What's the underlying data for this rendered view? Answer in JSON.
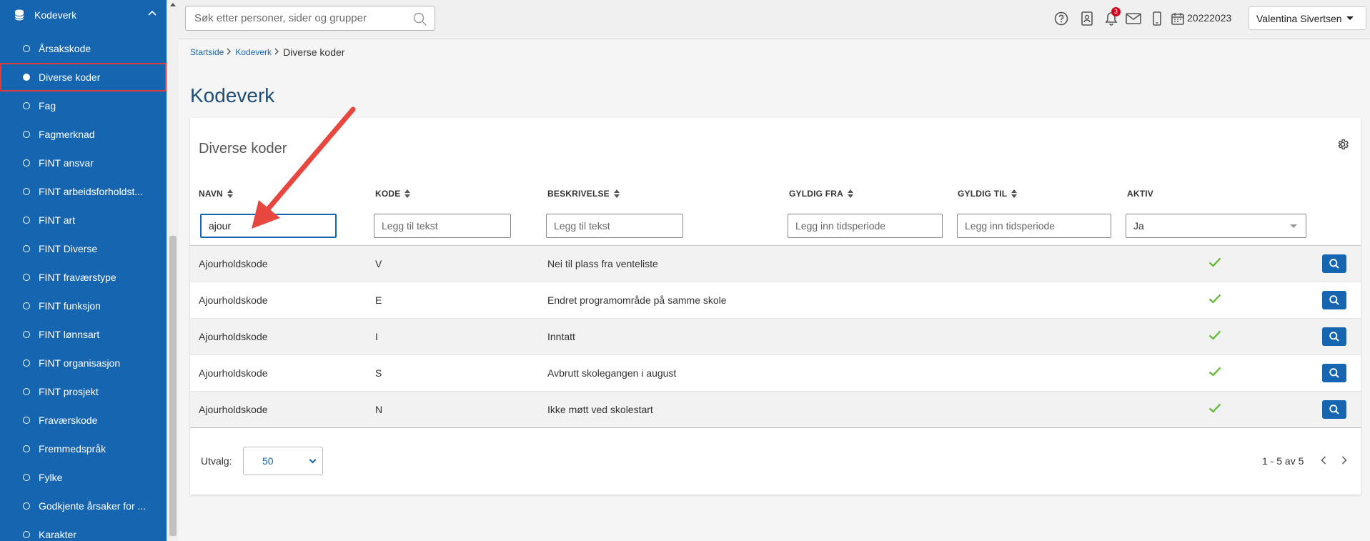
{
  "sidebar": {
    "section_title": "Kodeverk",
    "items": [
      {
        "label": "Årsakskode",
        "active": false
      },
      {
        "label": "Diverse koder",
        "active": true
      },
      {
        "label": "Fag",
        "active": false
      },
      {
        "label": "Fagmerknad",
        "active": false
      },
      {
        "label": "FINT ansvar",
        "active": false
      },
      {
        "label": "FINT arbeidsforholdst...",
        "active": false
      },
      {
        "label": "FINT art",
        "active": false
      },
      {
        "label": "FINT Diverse",
        "active": false
      },
      {
        "label": "FINT fraværstype",
        "active": false
      },
      {
        "label": "FINT funksjon",
        "active": false
      },
      {
        "label": "FINT lønnsart",
        "active": false
      },
      {
        "label": "FINT organisasjon",
        "active": false
      },
      {
        "label": "FINT prosjekt",
        "active": false
      },
      {
        "label": "Fraværskode",
        "active": false
      },
      {
        "label": "Fremmedspråk",
        "active": false
      },
      {
        "label": "Fylke",
        "active": false
      },
      {
        "label": "Godkjente årsaker for ...",
        "active": false
      },
      {
        "label": "Karakter",
        "active": false
      }
    ]
  },
  "topbar": {
    "search_placeholder": "Søk etter personer, sider og grupper",
    "notification_count": "3",
    "school_year": "20222023",
    "user_name": "Valentina Sivertsen"
  },
  "breadcrumb": {
    "items": [
      "Startside",
      "Kodeverk"
    ],
    "current": "Diverse koder"
  },
  "page_title": "Kodeverk",
  "panel": {
    "title": "Diverse koder",
    "columns": {
      "navn": "NAVN",
      "kode": "KODE",
      "beskrivelse": "BESKRIVELSE",
      "gyldig_fra": "GYLDIG FRA",
      "gyldig_til": "GYLDIG TIL",
      "aktiv": "AKTIV"
    },
    "filters": {
      "navn_value": "ajour",
      "kode_placeholder": "Legg til tekst",
      "beskrivelse_placeholder": "Legg til tekst",
      "gyldig_fra_placeholder": "Legg inn tidsperiode",
      "gyldig_til_placeholder": "Legg inn tidsperiode",
      "aktiv_value": "Ja"
    },
    "rows": [
      {
        "navn": "Ajourholdskode",
        "kode": "V",
        "beskrivelse": "Nei til plass fra venteliste",
        "aktiv": true
      },
      {
        "navn": "Ajourholdskode",
        "kode": "E",
        "beskrivelse": "Endret programområde på samme skole",
        "aktiv": true
      },
      {
        "navn": "Ajourholdskode",
        "kode": "I",
        "beskrivelse": "Inntatt",
        "aktiv": true
      },
      {
        "navn": "Ajourholdskode",
        "kode": "S",
        "beskrivelse": "Avbrutt skolegangen i august",
        "aktiv": true
      },
      {
        "navn": "Ajourholdskode",
        "kode": "N",
        "beskrivelse": "Ikke møtt ved skolestart",
        "aktiv": true
      }
    ],
    "footer": {
      "utvalg_label": "Utvalg:",
      "utvalg_value": "50",
      "pager_text": "1 - 5 av 5"
    }
  },
  "colors": {
    "brand": "#1565b0",
    "highlight": "#e03c3c",
    "check": "#5cb82e",
    "badge": "#d0021b"
  }
}
